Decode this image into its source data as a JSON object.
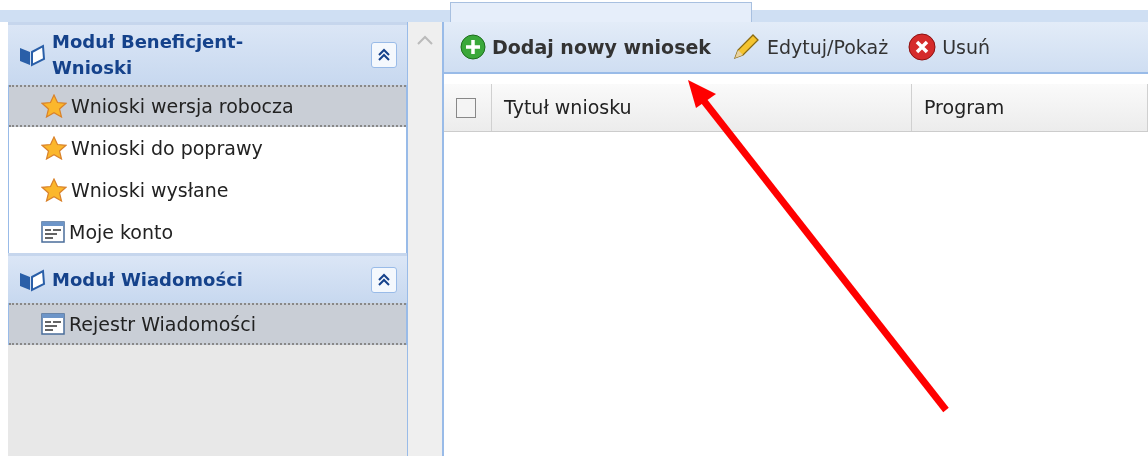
{
  "sidebar": {
    "modules": [
      {
        "title": "Moduł Beneficjent-Wnioski",
        "expanded": true,
        "items": [
          {
            "label": "Wnioski wersja robocza",
            "kind": "star",
            "selected": true
          },
          {
            "label": "Wnioski do poprawy",
            "kind": "star",
            "selected": false
          },
          {
            "label": "Wnioski wysłane",
            "kind": "star",
            "selected": false
          },
          {
            "label": "Moje konto",
            "kind": "form",
            "selected": false
          }
        ]
      },
      {
        "title": "Moduł Wiadomości",
        "expanded": true,
        "items": [
          {
            "label": "Rejestr Wiadomości",
            "kind": "form",
            "selected": true
          }
        ]
      }
    ]
  },
  "toolbar": {
    "buttons": [
      {
        "label": "Dodaj nowy wniosek",
        "kind": "add"
      },
      {
        "label": "Edytuj/Pokaż",
        "kind": "edit"
      },
      {
        "label": "Usuń",
        "kind": "delete"
      }
    ]
  },
  "grid": {
    "select_all_checked": false,
    "columns": [
      "Tytuł wniosku",
      "Program"
    ]
  }
}
